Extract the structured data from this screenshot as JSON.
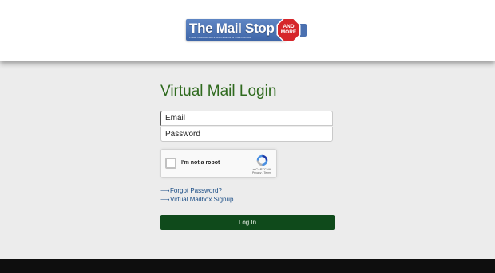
{
  "logo": {
    "name": "The Mail Stop",
    "stop_line1": "AND",
    "stop_line2": "MORE",
    "tagline": "Private mailboxes with a street address for small business"
  },
  "login": {
    "title": "Virtual Mail Login",
    "email_placeholder": "Email",
    "password_placeholder": "Password",
    "login_button": "Log In"
  },
  "recaptcha": {
    "label": "I'm not a robot",
    "brand": "reCAPTCHA",
    "terms": "Privacy - Terms"
  },
  "links": {
    "forgot_password": "Forgot Password?",
    "signup": "Virtual Mailbox Signup",
    "arrow": "⟶"
  },
  "colors": {
    "title": "#2f6a1e",
    "button": "#0f4a1b",
    "link": "#1a4d86",
    "footer": "#0e0e0e",
    "stop_sign": "#d6262b"
  }
}
